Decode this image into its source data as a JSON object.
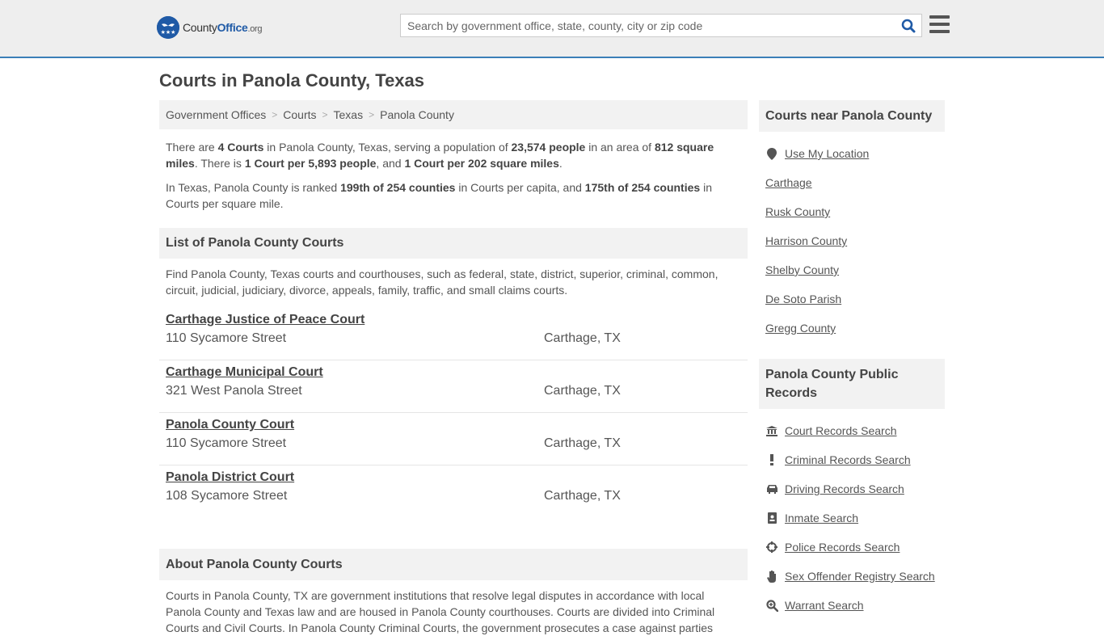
{
  "header": {
    "logo_text_a": "County",
    "logo_text_b": "Office",
    "logo_text_c": ".org",
    "search_placeholder": "Search by government office, state, county, city or zip code",
    "accent_color": "#1f5aa6"
  },
  "page_title": "Courts in Panola County, Texas",
  "breadcrumb": [
    "Government Offices",
    "Courts",
    "Texas",
    "Panola County"
  ],
  "intro": {
    "p1": [
      "There are ",
      "4 Courts",
      " in Panola County, Texas, serving a population of ",
      "23,574 people",
      " in an area of ",
      "812 square miles",
      ". There is ",
      "1 Court per 5,893 people",
      ", and ",
      "1 Court per 202 square miles",
      "."
    ],
    "p2": [
      "In Texas, Panola County is ranked ",
      "199th of 254 counties",
      " in Courts per capita, and ",
      "175th of 254 counties",
      " in Courts per square mile."
    ]
  },
  "list_section": {
    "heading": "List of Panola County Courts",
    "description": "Find Panola County, Texas courts and courthouses, such as federal, state, district, superior, criminal, common, circuit, judicial, judiciary, divorce, appeals, family, traffic, and small claims courts.",
    "courts": [
      {
        "name": "Carthage Justice of Peace Court",
        "address": "110 Sycamore Street",
        "city": "Carthage, TX"
      },
      {
        "name": "Carthage Municipal Court",
        "address": "321 West Panola Street",
        "city": "Carthage, TX"
      },
      {
        "name": "Panola County Court",
        "address": "110 Sycamore Street",
        "city": "Carthage, TX"
      },
      {
        "name": "Panola District Court",
        "address": "108 Sycamore Street",
        "city": "Carthage, TX"
      }
    ]
  },
  "about_section": {
    "heading": "About Panola County Courts",
    "text": "Courts in Panola County, TX are government institutions that resolve legal disputes in accordance with local Panola County and Texas law and are housed in Panola County courthouses. Courts are divided into Criminal Courts and Civil Courts. In Panola County Criminal Courts, the government prosecutes a case against parties"
  },
  "sidebar": {
    "nearby_heading": "Courts near Panola County",
    "use_location": "Use My Location",
    "nearby": [
      "Carthage",
      "Rusk County",
      "Harrison County",
      "Shelby County",
      "De Soto Parish",
      "Gregg County"
    ],
    "records_heading": "Panola County Public Records",
    "records": [
      {
        "label": "Court Records Search",
        "icon": "courthouse-icon"
      },
      {
        "label": "Criminal Records Search",
        "icon": "exclamation-icon"
      },
      {
        "label": "Driving Records Search",
        "icon": "car-icon"
      },
      {
        "label": "Inmate Search",
        "icon": "id-badge-icon"
      },
      {
        "label": "Police Records Search",
        "icon": "crosshair-icon"
      },
      {
        "label": "Sex Offender Registry Search",
        "icon": "hand-icon"
      },
      {
        "label": "Warrant Search",
        "icon": "magnify-icon"
      }
    ]
  }
}
